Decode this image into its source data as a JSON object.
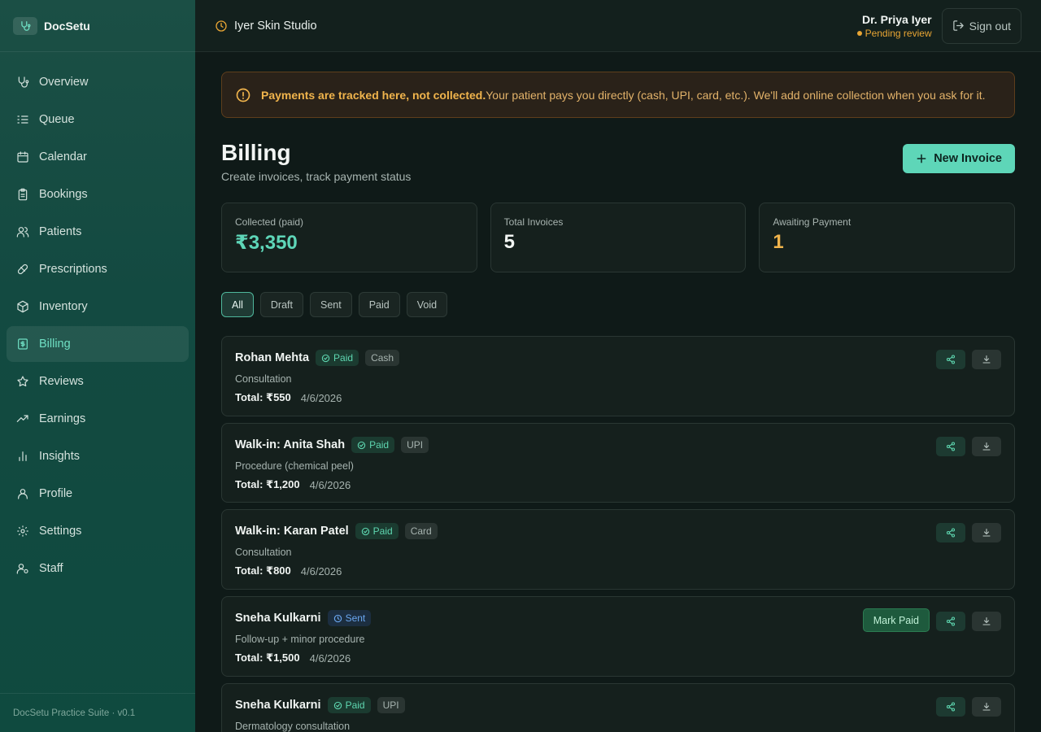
{
  "app": {
    "name": "DocSetu",
    "footer": "DocSetu Practice Suite · v0.1"
  },
  "sidebar": {
    "items": [
      {
        "label": "Overview",
        "icon": "stethoscope-icon"
      },
      {
        "label": "Queue",
        "icon": "list-icon"
      },
      {
        "label": "Calendar",
        "icon": "calendar-icon"
      },
      {
        "label": "Bookings",
        "icon": "clipboard-icon"
      },
      {
        "label": "Patients",
        "icon": "users-icon"
      },
      {
        "label": "Prescriptions",
        "icon": "pill-icon"
      },
      {
        "label": "Inventory",
        "icon": "box-icon"
      },
      {
        "label": "Billing",
        "icon": "receipt-icon",
        "active": true
      },
      {
        "label": "Reviews",
        "icon": "star-icon"
      },
      {
        "label": "Earnings",
        "icon": "trending-up-icon"
      },
      {
        "label": "Insights",
        "icon": "bar-chart-icon"
      },
      {
        "label": "Profile",
        "icon": "user-icon"
      },
      {
        "label": "Settings",
        "icon": "gear-icon"
      },
      {
        "label": "Staff",
        "icon": "user-cog-icon"
      }
    ]
  },
  "topbar": {
    "clinic": "Iyer Skin Studio",
    "user_name": "Dr. Priya Iyer",
    "user_status": "Pending review",
    "signout_label": "Sign out"
  },
  "banner": {
    "title": "Payments are tracked here, not collected.",
    "text": "Your patient pays you directly (cash, UPI, card, etc.). We'll add online collection when you ask for it."
  },
  "page": {
    "title": "Billing",
    "subtitle": "Create invoices, track payment status",
    "new_invoice_label": "New Invoice"
  },
  "stats": [
    {
      "label": "Collected (paid)",
      "value": "₹3,350",
      "color": "#5ed6b8"
    },
    {
      "label": "Total Invoices",
      "value": "5",
      "color": "#f2f5f3"
    },
    {
      "label": "Awaiting Payment",
      "value": "1",
      "color": "#f0b44c"
    }
  ],
  "filters": [
    {
      "label": "All",
      "active": true
    },
    {
      "label": "Draft"
    },
    {
      "label": "Sent"
    },
    {
      "label": "Paid"
    },
    {
      "label": "Void"
    }
  ],
  "invoices": [
    {
      "name": "Rohan Mehta",
      "status": "Paid",
      "method": "Cash",
      "desc": "Consultation",
      "total": "Total: ₹550",
      "date": "4/6/2026"
    },
    {
      "name": "Walk-in: Anita Shah",
      "status": "Paid",
      "method": "UPI",
      "desc": "Procedure (chemical peel)",
      "total": "Total: ₹1,200",
      "date": "4/6/2026"
    },
    {
      "name": "Walk-in: Karan Patel",
      "status": "Paid",
      "method": "Card",
      "desc": "Consultation",
      "total": "Total: ₹800",
      "date": "4/6/2026"
    },
    {
      "name": "Sneha Kulkarni",
      "status": "Sent",
      "method": "",
      "desc": "Follow-up + minor procedure",
      "total": "Total: ₹1,500",
      "date": "4/6/2026",
      "mark_paid_label": "Mark Paid"
    },
    {
      "name": "Sneha Kulkarni",
      "status": "Paid",
      "method": "UPI",
      "desc": "Dermatology consultation",
      "total": "",
      "date": ""
    }
  ]
}
